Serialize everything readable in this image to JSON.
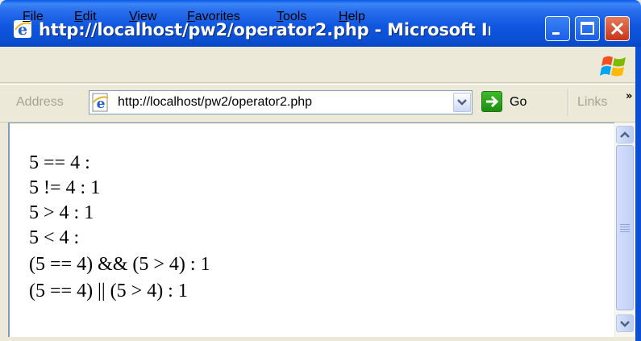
{
  "window": {
    "title": "http://localhost/pw2/operator2.php - Microsoft In..."
  },
  "menu": {
    "items": [
      {
        "label": "File"
      },
      {
        "label": "Edit"
      },
      {
        "label": "View"
      },
      {
        "label": "Favorites"
      },
      {
        "label": "Tools"
      },
      {
        "label": "Help"
      }
    ]
  },
  "address_bar": {
    "label": "Address",
    "url": "http://localhost/pw2/operator2.php",
    "go_label": "Go",
    "links_label": "Links",
    "more_glyph": "»"
  },
  "page": {
    "lines": [
      "5 == 4 :",
      "5 != 4 : 1",
      "5 > 4 : 1",
      "5 < 4 :",
      "(5 == 4) && (5 > 4) : 1",
      "(5 == 4) || (5 > 4) : 1"
    ]
  },
  "colors": {
    "titlebar": "#0b4fd3",
    "chrome": "#ece9d8",
    "close_button": "#c8361a",
    "go_button": "#1d8e12"
  }
}
